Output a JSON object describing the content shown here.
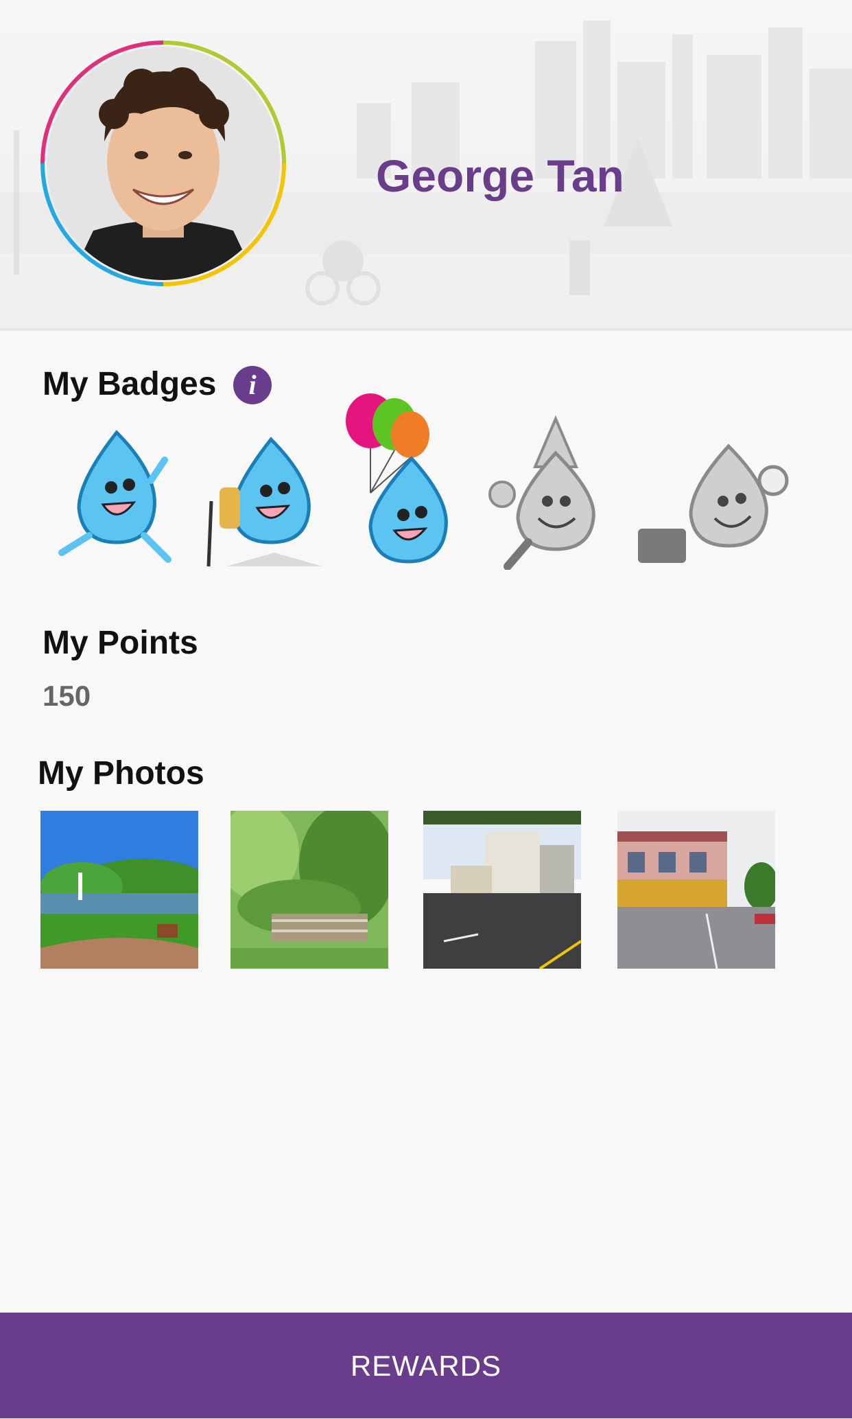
{
  "profile": {
    "name": "George Tan"
  },
  "badges": {
    "title": "My Badges",
    "info_glyph": "i",
    "items": [
      {
        "name": "running-droplet",
        "earned": true
      },
      {
        "name": "hiking-droplet",
        "earned": true
      },
      {
        "name": "balloon-droplet",
        "earned": true
      },
      {
        "name": "party-droplet",
        "earned": false
      },
      {
        "name": "explorer-droplet",
        "earned": false
      }
    ]
  },
  "points": {
    "title": "My Points",
    "value": "150"
  },
  "photos": {
    "title": "My Photos",
    "items": [
      {
        "subject": "park-lake"
      },
      {
        "subject": "park-bridge"
      },
      {
        "subject": "street-corner"
      },
      {
        "subject": "shophouse"
      }
    ]
  },
  "footer": {
    "rewards_label": "REWARDS"
  },
  "colors": {
    "brand": "#6a3d8c",
    "earned_badge": "#5bc4f0",
    "locked_badge": "#9b9b9b"
  }
}
